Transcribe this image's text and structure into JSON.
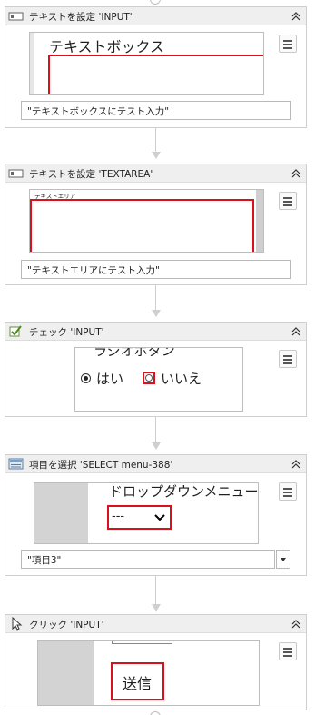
{
  "steps": [
    {
      "title": "テキストを設定 'INPUT'",
      "preview": {
        "label": "テキストボックス"
      },
      "value": "\"テキストボックスにテスト入力\""
    },
    {
      "title": "テキストを設定 'TEXTAREA'",
      "preview": {
        "label": "テキストエリア"
      },
      "value": "\"テキストエリアにテスト入力\""
    },
    {
      "title": "チェック 'INPUT'",
      "preview": {
        "label": "ラジオボタン",
        "option_yes": "はい",
        "option_no": "いいえ"
      }
    },
    {
      "title": "項目を選択 'SELECT  menu-388'",
      "preview": {
        "label": "ドロップダウンメニュー",
        "selected": "---"
      },
      "value": "\"項目3\""
    },
    {
      "title": "クリック 'INPUT'",
      "preview": {
        "button": "送信"
      }
    }
  ],
  "colors": {
    "highlight": "#d9111c",
    "header_bg": "#efefef",
    "border": "#cfcfcf"
  }
}
